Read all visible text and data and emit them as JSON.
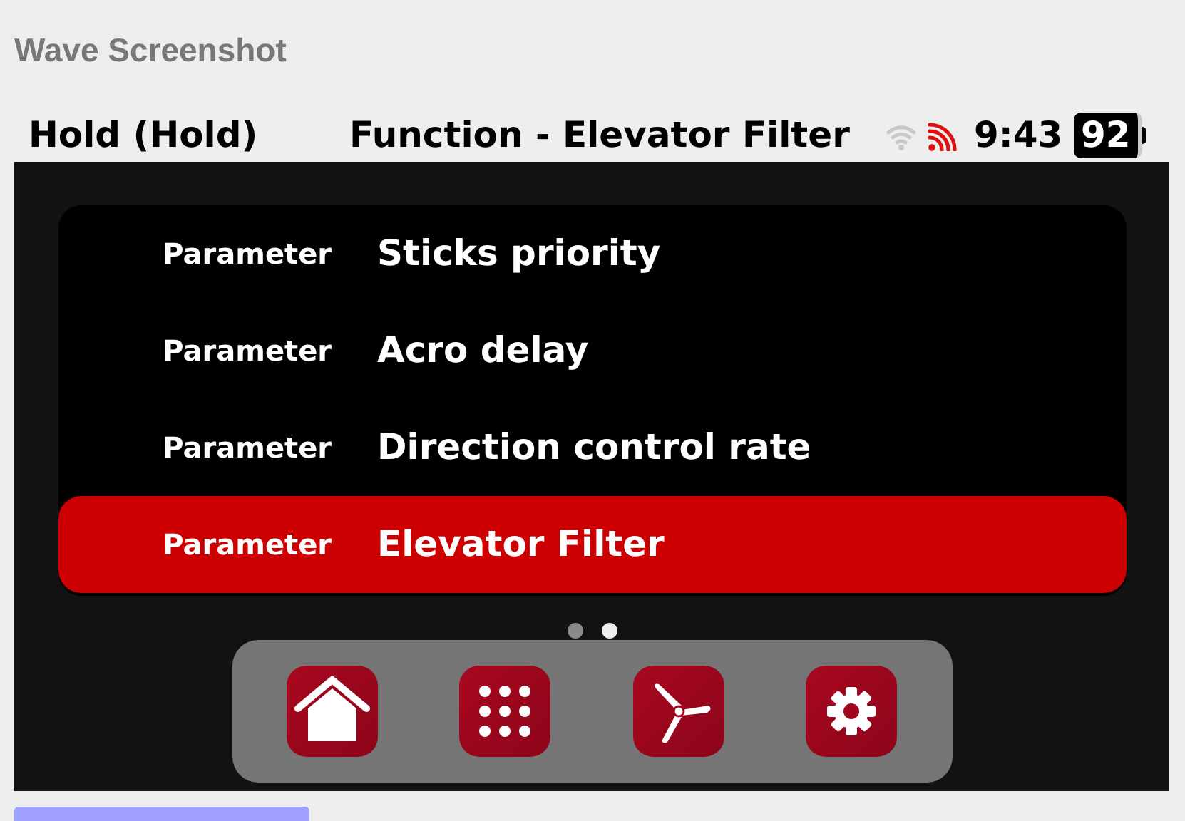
{
  "page_title": "Wave Screenshot",
  "status_bar": {
    "mode": "Hold (Hold)",
    "title": "Function - Elevator Filter",
    "time": "9:43",
    "battery": "92"
  },
  "parameters": [
    {
      "label": "Parameter",
      "value": "Sticks priority",
      "selected": false
    },
    {
      "label": "Parameter",
      "value": "Acro delay",
      "selected": false
    },
    {
      "label": "Parameter",
      "value": "Direction control rate",
      "selected": false
    },
    {
      "label": "Parameter",
      "value": "Elevator Filter",
      "selected": true
    }
  ],
  "pager": [
    {
      "selected": false
    },
    {
      "selected": true
    }
  ],
  "dock": [
    {
      "kind": "home"
    },
    {
      "kind": "apps"
    },
    {
      "kind": "propeller"
    },
    {
      "kind": "settings"
    }
  ]
}
